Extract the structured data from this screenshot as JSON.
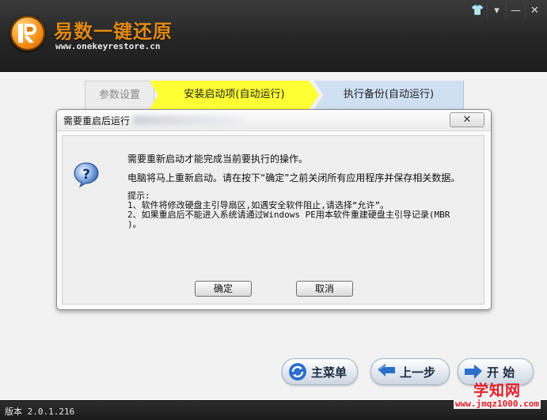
{
  "app": {
    "title": "易数一键还原",
    "url": "www.onekeyrestore.cn",
    "version": "版本 2.0.1.216"
  },
  "window_controls": [
    {
      "name": "skin-icon",
      "glyph": "👕"
    },
    {
      "name": "menu-icon",
      "glyph": "▾"
    },
    {
      "name": "minimize-icon",
      "glyph": "—"
    },
    {
      "name": "close-icon",
      "glyph": "✕"
    }
  ],
  "steps": [
    {
      "label": "参数设置",
      "state": "done"
    },
    {
      "label": "安装启动项(自动运行)",
      "state": "current"
    },
    {
      "label": "执行备份(自动运行)",
      "state": "pending"
    }
  ],
  "dialog": {
    "title": "需要重启后运行",
    "close_glyph": "✕",
    "message_1": "需要重新启动才能完成当前要执行的操作。",
    "message_2": "电脑将马上重新启动。请在按下“确定”之前关闭所有应用程序并保存相关数据。",
    "tips_title": "提示:",
    "tips": [
      "1、软件将修改硬盘主引导扇区,如遇安全软件阻止,请选择“允许”。",
      "2、如果重启后不能进入系统请通过Windows PE用本软件重建硬盘主引导记录(MBR",
      ")。"
    ],
    "ok_label": "确定",
    "cancel_label": "取消"
  },
  "nav": {
    "menu_label": "主菜单",
    "prev_label": "上一步",
    "start_label": "开 始"
  },
  "watermark": {
    "big": "学知网",
    "small": "www.jmqz1000.com"
  },
  "colors": {
    "accent_orange": "#e08a17",
    "step_current": "#ffff33",
    "step_pending": "#cfe0f3",
    "watermark_red": "#e0202a"
  }
}
